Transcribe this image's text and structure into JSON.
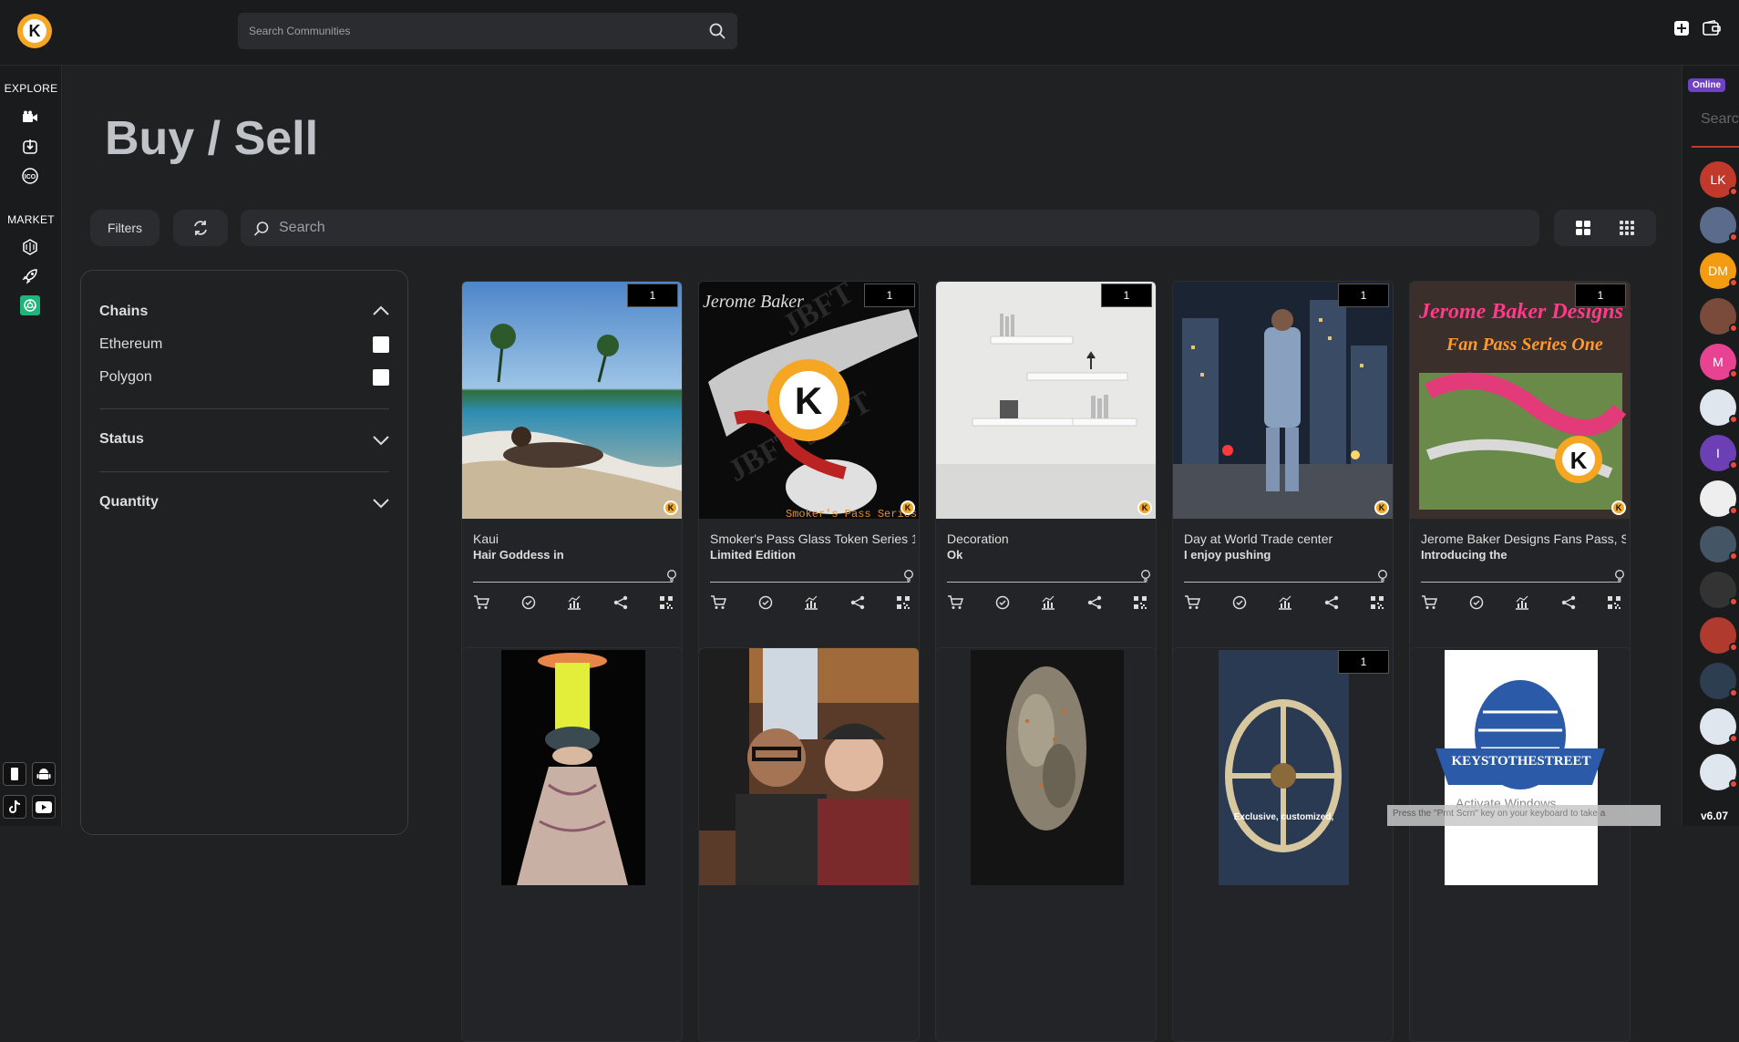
{
  "header": {
    "logo_letter": "K",
    "search_placeholder": "Search Communities",
    "icons": [
      "plus-square-icon",
      "wallet-icon"
    ]
  },
  "leftnav": {
    "explore_label": "EXPLORE",
    "market_label": "MARKET",
    "explore_icons": [
      "video-icon",
      "download-icon",
      "ico-icon"
    ],
    "market_icons": [
      "nft-icon",
      "rocket-icon",
      "chatgpt-icon"
    ],
    "bottom_icons": [
      "mobile-icon",
      "android-icon",
      "tiktok-icon",
      "youtube-icon"
    ]
  },
  "page": {
    "title": "Buy / Sell",
    "filters_label": "Filters",
    "search_placeholder": "Search"
  },
  "filters": {
    "chains_label": "Chains",
    "options": [
      "Ethereum",
      "Polygon"
    ],
    "status_label": "Status",
    "quantity_label": "Quantity"
  },
  "cards": [
    {
      "name": "Kaui",
      "desc": "Hair Goddess in",
      "count": "1"
    },
    {
      "name": "Smoker's Pass Glass Token Series 1",
      "desc": "Limited Edition",
      "count": "1"
    },
    {
      "name": "Decoration",
      "desc": "Ok",
      "count": "1"
    },
    {
      "name": "Day at World Trade center",
      "desc": "I enjoy pushing",
      "count": "1"
    },
    {
      "name": "Jerome Baker Designs Fans Pass, S",
      "desc": "Introducing the",
      "count": "1"
    }
  ],
  "row2": {
    "badge": "1",
    "keys_text": "KEYSTOTHESTREET",
    "exclusive_text": "Exclusive, customized,"
  },
  "rightbar": {
    "online_label": "Online",
    "search_placeholder": "Searc",
    "avatars": [
      {
        "initials": "LK",
        "color": "#c0392b"
      },
      {
        "initials": "",
        "color": "#5a6b8c"
      },
      {
        "initials": "DM",
        "color": "#f39c12"
      },
      {
        "initials": "",
        "color": "#7a4b3a"
      },
      {
        "initials": "M",
        "color": "#e84393"
      },
      {
        "initials": "",
        "color": "#dfe6ee"
      },
      {
        "initials": "I",
        "color": "#6c3fb5"
      },
      {
        "initials": "",
        "color": "#eeeeee"
      },
      {
        "initials": "",
        "color": "#445566"
      },
      {
        "initials": "",
        "color": "#333333"
      },
      {
        "initials": "",
        "color": "#b03a2e"
      },
      {
        "initials": "",
        "color": "#2d3e50"
      },
      {
        "initials": "",
        "color": "#dfe6ee"
      },
      {
        "initials": "",
        "color": "#dfe6ee"
      }
    ],
    "version": "v6.07"
  },
  "watermark": {
    "text": "Activate Windows",
    "hint": "Press the \"Prnt Scrn\" key on your keyboard to take a"
  }
}
